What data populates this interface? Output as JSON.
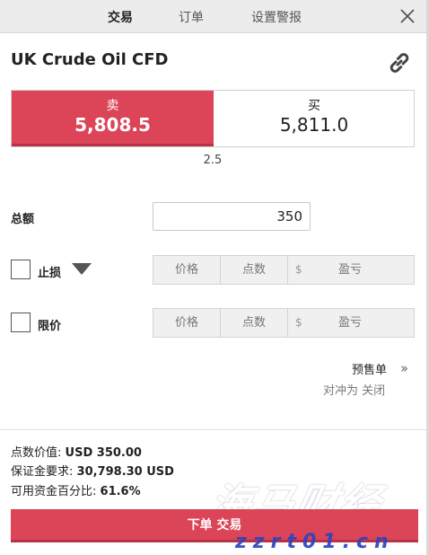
{
  "tabs": [
    {
      "label": "交易",
      "active": true
    },
    {
      "label": "订单",
      "active": false
    },
    {
      "label": "设置警报",
      "active": false
    }
  ],
  "instrument": "UK Crude Oil CFD",
  "prices": {
    "sell_label": "卖",
    "sell": "5,808.5",
    "buy_label": "买",
    "buy": "5,811.0",
    "spread": "2.5"
  },
  "amount": {
    "label": "总额",
    "value": "350"
  },
  "stop": {
    "label": "止损",
    "price": "价格",
    "points": "点数",
    "currency": "$",
    "pl": "盈亏"
  },
  "limit": {
    "label": "限价",
    "price": "价格",
    "points": "点数",
    "currency": "$",
    "pl": "盈亏"
  },
  "order": {
    "label": "预售单",
    "hedge": "对冲为 关闭"
  },
  "info": {
    "point_value_label": "点数价值:",
    "point_value": "USD 350.00",
    "margin_label": "保证金要求:",
    "margin": "30,798.30 USD",
    "available_label": "可用资金百分比:",
    "available": "61.6%"
  },
  "watermark": {
    "text": "海马财经",
    "url": "zzrt01.cn"
  },
  "submit_label": "下单 交易",
  "colors": {
    "sell": "#dc4458",
    "accent_dark": "#b53344"
  },
  "icons": [
    "close-icon",
    "link-icon",
    "dropdown-triangle-icon",
    "double-chevron-right-icon"
  ]
}
